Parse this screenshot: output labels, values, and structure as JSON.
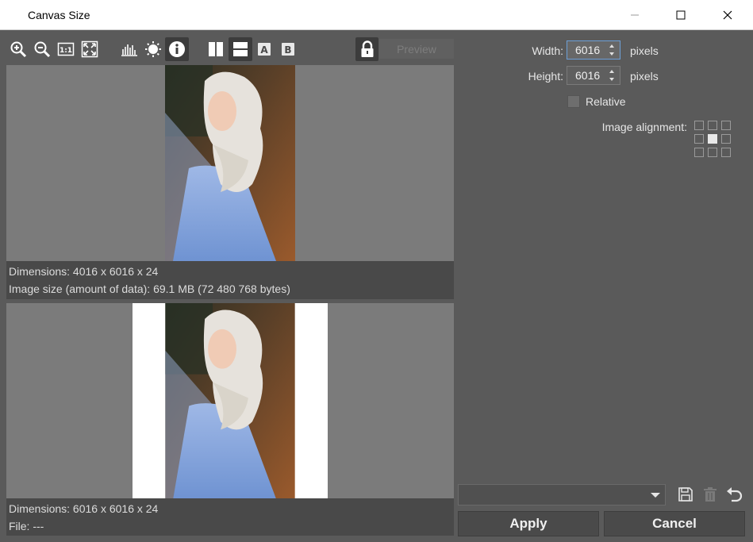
{
  "window": {
    "title": "Canvas Size"
  },
  "toolbar": {
    "preview_label": "Preview"
  },
  "source": {
    "dimensions": "Dimensions: 4016 x 6016 x 24",
    "size": "Image size (amount of data): 69.1 MB (72 480 768 bytes)"
  },
  "result": {
    "dimensions": "Dimensions: 6016 x 6016 x 24",
    "file": "File:  ---"
  },
  "settings": {
    "width_label": "Width:",
    "width_value": "6016",
    "height_label": "Height:",
    "height_value": "6016",
    "unit": "pixels",
    "relative_label": "Relative",
    "relative_checked": false,
    "alignment_label": "Image alignment:",
    "alignment_selected": "center"
  },
  "presets": {
    "selected": ""
  },
  "buttons": {
    "apply": "Apply",
    "cancel": "Cancel"
  },
  "colors": {
    "background": "#5a5a5a",
    "preview_bg": "#7b7b7b",
    "info_bar": "#494949",
    "accent": "#6d9fd6"
  }
}
